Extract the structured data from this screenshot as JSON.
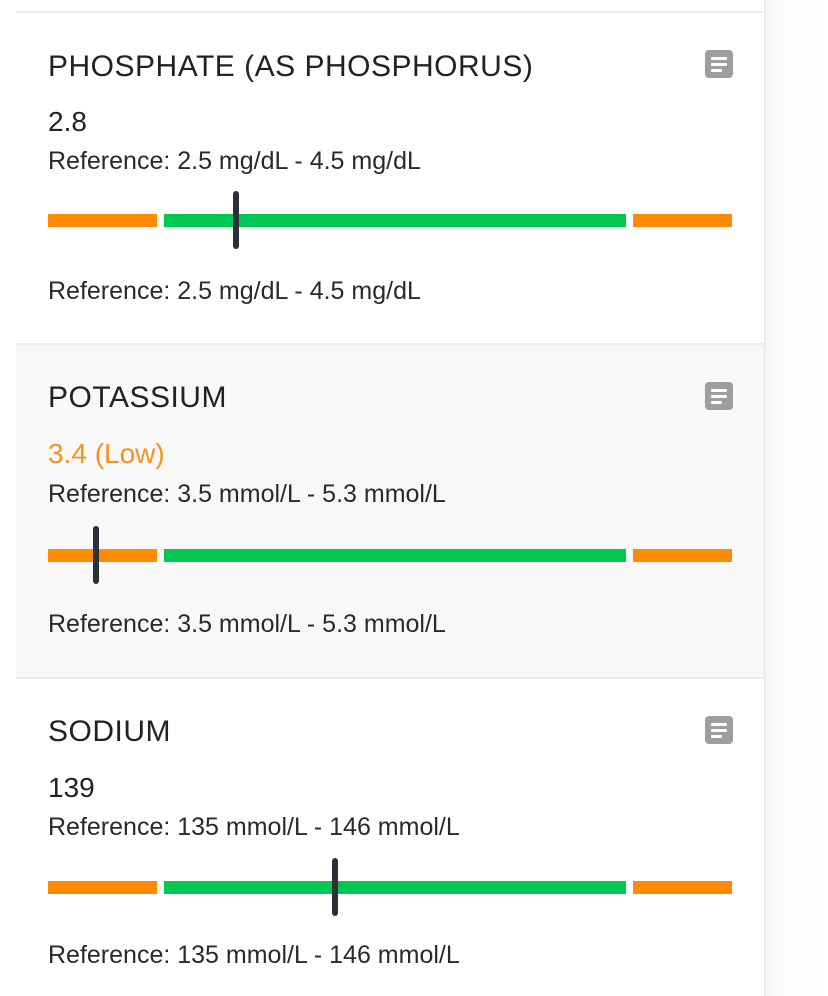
{
  "results": [
    {
      "title": "PHOSPHATE (AS PHOSPHORUS)",
      "value_text": "2.8",
      "status": "normal",
      "reference_text": "Reference: 2.5 mg/dL - 4.5 mg/dL",
      "reference_footer": "Reference: 2.5 mg/dL - 4.5 mg/dL",
      "gauge_position": 0.275,
      "icon": "note-icon"
    },
    {
      "title": "POTASSIUM",
      "value_text": "3.4 (Low)",
      "status": "low",
      "reference_text": "Reference: 3.5 mmol/L - 5.3 mmol/L",
      "reference_footer": "Reference: 3.5 mmol/L - 5.3 mmol/L",
      "gauge_position": 0.07,
      "icon": "note-icon"
    },
    {
      "title": "SODIUM",
      "value_text": "139",
      "status": "normal",
      "reference_text": "Reference: 135 mmol/L - 146 mmol/L",
      "reference_footer": "Reference: 135 mmol/L - 146 mmol/L",
      "gauge_position": 0.42,
      "icon": "note-icon"
    }
  ],
  "colors": {
    "out_of_range": "#ff8c00",
    "in_range": "#00c853",
    "low_text": "#f5931e",
    "marker": "#2b3138",
    "icon": "#9e9e9e"
  }
}
